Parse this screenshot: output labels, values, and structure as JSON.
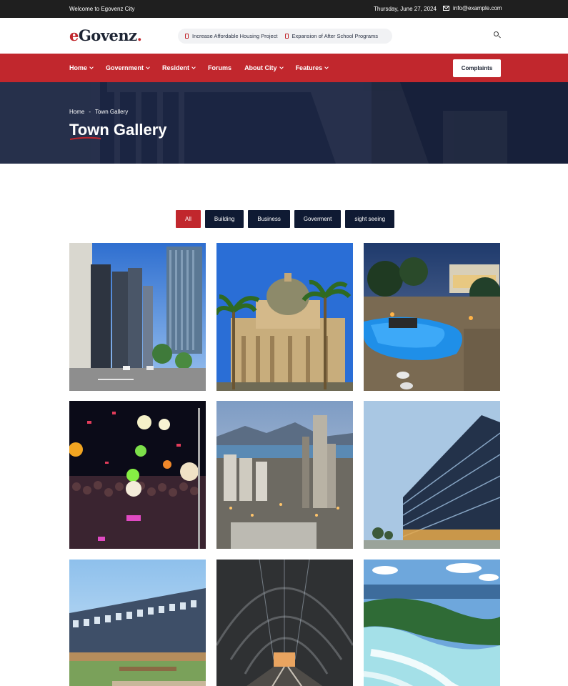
{
  "topbar": {
    "welcome": "Welcome to Egovenz City",
    "date": "Thursday, June 27, 2024",
    "email": "info@example.com"
  },
  "header": {
    "logo_e": "e",
    "logo_rest": "Govenz",
    "logo_dot": ".",
    "ticker": [
      "Increase Affordable Housing Project",
      "Expansion of After School Programs"
    ]
  },
  "nav": {
    "items": [
      {
        "label": "Home",
        "dropdown": true
      },
      {
        "label": "Government",
        "dropdown": true
      },
      {
        "label": "Resident",
        "dropdown": true
      },
      {
        "label": "Forums",
        "dropdown": false
      },
      {
        "label": "About City",
        "dropdown": true
      },
      {
        "label": "Features",
        "dropdown": true
      }
    ],
    "cta": "Complaints"
  },
  "hero": {
    "breadcrumb_home": "Home",
    "breadcrumb_sep": "-",
    "breadcrumb_current": "Town Gallery",
    "title": "Town Gallery"
  },
  "filters": {
    "items": [
      "All",
      "Building",
      "Business",
      "Goverment",
      "sight seeing"
    ],
    "active": "All"
  },
  "gallery": {
    "items": [
      {
        "subject": "city-street-skyscrapers"
      },
      {
        "subject": "domed-building-palms"
      },
      {
        "subject": "resort-pool-night"
      },
      {
        "subject": "concert-balloons"
      },
      {
        "subject": "industrial-plant-coast"
      },
      {
        "subject": "glass-office-building"
      },
      {
        "subject": "modern-campus-building"
      },
      {
        "subject": "train-station-arches"
      },
      {
        "subject": "beach-aerial"
      }
    ]
  },
  "colors": {
    "brand_red": "#c1272d",
    "navy": "#0f1a33",
    "topbar": "#1f1f1f"
  }
}
